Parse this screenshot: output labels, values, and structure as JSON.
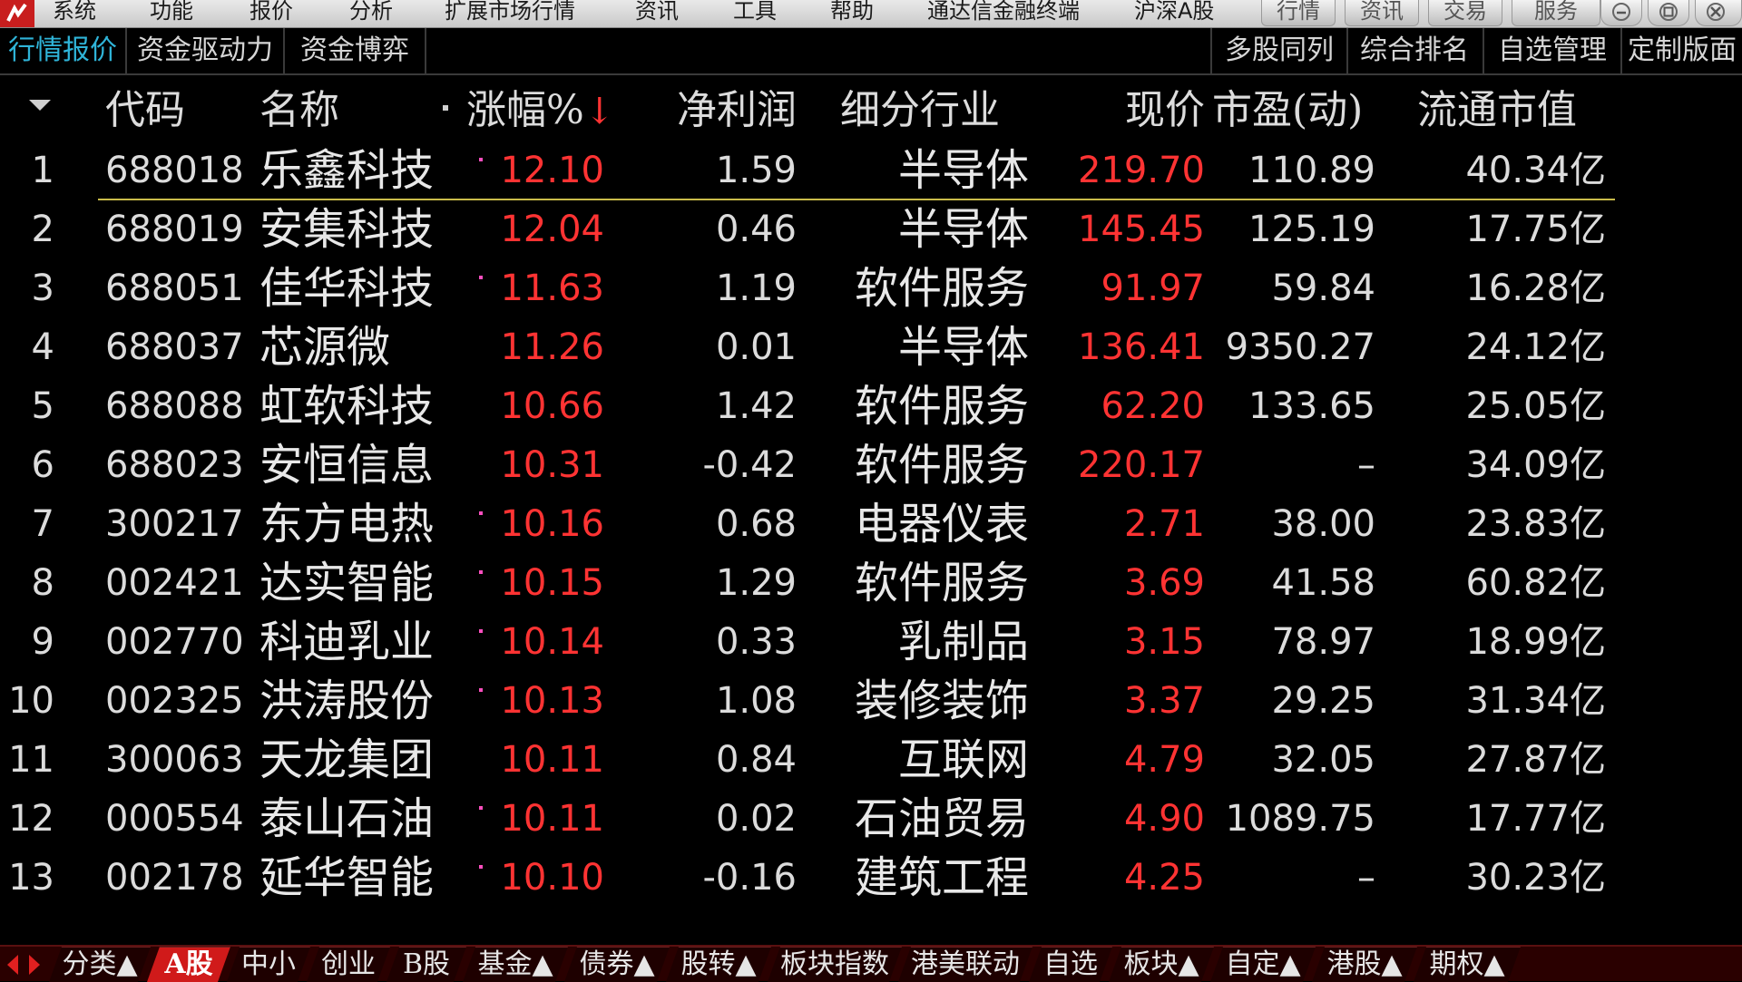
{
  "menu": {
    "items": [
      "系统",
      "功能",
      "报价",
      "分析",
      "扩展市场行情",
      "资讯",
      "工具",
      "帮助"
    ],
    "app_title": "通达信金融终端",
    "market_title": "沪深A股",
    "window_tabs": [
      "行情",
      "资讯",
      "交易",
      "服务"
    ]
  },
  "tabs": {
    "left": [
      "行情报价",
      "资金驱动力",
      "资金博弈"
    ],
    "right": [
      "多股同列",
      "综合排名",
      "自选管理",
      "定制版面"
    ]
  },
  "table": {
    "headers": {
      "code": "代码",
      "name": "名称",
      "change": "涨幅%",
      "sort_arrow": "↓",
      "net_profit": "净利润",
      "industry": "细分行业",
      "price": "现价",
      "pe": "市盈(动)",
      "float_mcap": "流通市值"
    },
    "rows": [
      {
        "idx": "1",
        "code": "688018",
        "name": "乐鑫科技",
        "dot": true,
        "change": "12.10",
        "net_profit": "1.59",
        "industry": "半导体",
        "price": "219.70",
        "pe": "110.89",
        "float_mcap": "40.34亿"
      },
      {
        "idx": "2",
        "code": "688019",
        "name": "安集科技",
        "dot": false,
        "change": "12.04",
        "net_profit": "0.46",
        "industry": "半导体",
        "price": "145.45",
        "pe": "125.19",
        "float_mcap": "17.75亿"
      },
      {
        "idx": "3",
        "code": "688051",
        "name": "佳华科技",
        "dot": true,
        "change": "11.63",
        "net_profit": "1.19",
        "industry": "软件服务",
        "price": "91.97",
        "pe": "59.84",
        "float_mcap": "16.28亿"
      },
      {
        "idx": "4",
        "code": "688037",
        "name": "芯源微",
        "dot": false,
        "change": "11.26",
        "net_profit": "0.01",
        "industry": "半导体",
        "price": "136.41",
        "pe": "9350.27",
        "float_mcap": "24.12亿"
      },
      {
        "idx": "5",
        "code": "688088",
        "name": "虹软科技",
        "dot": false,
        "change": "10.66",
        "net_profit": "1.42",
        "industry": "软件服务",
        "price": "62.20",
        "pe": "133.65",
        "float_mcap": "25.05亿"
      },
      {
        "idx": "6",
        "code": "688023",
        "name": "安恒信息",
        "dot": false,
        "change": "10.31",
        "net_profit": "-0.42",
        "industry": "软件服务",
        "price": "220.17",
        "pe": "–",
        "float_mcap": "34.09亿"
      },
      {
        "idx": "7",
        "code": "300217",
        "name": "东方电热",
        "dot": true,
        "change": "10.16",
        "net_profit": "0.68",
        "industry": "电器仪表",
        "price": "2.71",
        "pe": "38.00",
        "float_mcap": "23.83亿"
      },
      {
        "idx": "8",
        "code": "002421",
        "name": "达实智能",
        "dot": true,
        "change": "10.15",
        "net_profit": "1.29",
        "industry": "软件服务",
        "price": "3.69",
        "pe": "41.58",
        "float_mcap": "60.82亿"
      },
      {
        "idx": "9",
        "code": "002770",
        "name": "科迪乳业",
        "dot": true,
        "change": "10.14",
        "net_profit": "0.33",
        "industry": "乳制品",
        "price": "3.15",
        "pe": "78.97",
        "float_mcap": "18.99亿"
      },
      {
        "idx": "10",
        "code": "002325",
        "name": "洪涛股份",
        "dot": true,
        "change": "10.13",
        "net_profit": "1.08",
        "industry": "装修装饰",
        "price": "3.37",
        "pe": "29.25",
        "float_mcap": "31.34亿"
      },
      {
        "idx": "11",
        "code": "300063",
        "name": "天龙集团",
        "dot": false,
        "change": "10.11",
        "net_profit": "0.84",
        "industry": "互联网",
        "price": "4.79",
        "pe": "32.05",
        "float_mcap": "27.87亿"
      },
      {
        "idx": "12",
        "code": "000554",
        "name": "泰山石油",
        "dot": true,
        "change": "10.11",
        "net_profit": "0.02",
        "industry": "石油贸易",
        "price": "4.90",
        "pe": "1089.75",
        "float_mcap": "17.77亿"
      },
      {
        "idx": "13",
        "code": "002178",
        "name": "延华智能",
        "dot": true,
        "change": "10.10",
        "net_profit": "-0.16",
        "industry": "建筑工程",
        "price": "4.25",
        "pe": "–",
        "float_mcap": "30.23亿"
      }
    ]
  },
  "bottom_tabs": [
    {
      "label": "分类▲",
      "active": false
    },
    {
      "label": "A股",
      "active": true
    },
    {
      "label": "中小",
      "active": false
    },
    {
      "label": "创业",
      "active": false
    },
    {
      "label": "B股",
      "active": false
    },
    {
      "label": "基金▲",
      "active": false
    },
    {
      "label": "债券▲",
      "active": false
    },
    {
      "label": "股转▲",
      "active": false
    },
    {
      "label": "板块指数",
      "active": false
    },
    {
      "label": "港美联动",
      "active": false
    },
    {
      "label": "自选",
      "active": false
    },
    {
      "label": "板块▲",
      "active": false
    },
    {
      "label": "自定▲",
      "active": false
    },
    {
      "label": "港股▲",
      "active": false
    },
    {
      "label": "期权▲",
      "active": false
    }
  ],
  "colors": {
    "price_up": "#ff3333",
    "active_tab_text": "#2fb4d8",
    "active_bottom_tab": "#d01a1a",
    "selected_row_underline": "#c9bb4a"
  },
  "icons": {
    "logo": "app-logo-icon",
    "minimize": "minimize-icon",
    "maximize": "maximize-icon",
    "close": "close-icon",
    "sort_caret": "sort-caret-icon",
    "nav_left": "scroll-left-icon",
    "nav_right": "scroll-right-icon"
  }
}
